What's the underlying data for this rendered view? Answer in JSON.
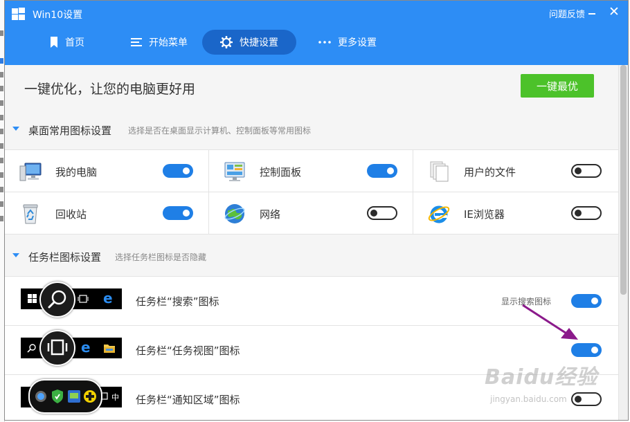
{
  "app": {
    "title": "Win10设置",
    "feedback": "问题反馈",
    "close_glyph": "✕"
  },
  "nav": {
    "tabs": [
      {
        "label": "首页",
        "icon": "bookmark-icon",
        "active": false
      },
      {
        "label": "开始菜单",
        "icon": "menu-icon",
        "active": false
      },
      {
        "label": "快捷设置",
        "icon": "gear-icon",
        "active": true
      },
      {
        "label": "更多设置",
        "icon": "more-icon",
        "active": false
      }
    ]
  },
  "optimize": {
    "text": "一键优化，让您的电脑更好用",
    "button": "一键最优"
  },
  "desktop_section": {
    "title": "桌面常用图标设置",
    "desc": "选择是否在桌面显示计算机、控制面板等常用图标",
    "items": [
      {
        "label": "我的电脑",
        "icon": "computer-icon",
        "on": true
      },
      {
        "label": "控制面板",
        "icon": "control-panel-icon",
        "on": true
      },
      {
        "label": "用户的文件",
        "icon": "documents-icon",
        "on": false
      },
      {
        "label": "回收站",
        "icon": "recycle-bin-icon",
        "on": true
      },
      {
        "label": "网络",
        "icon": "network-globe-icon",
        "on": false
      },
      {
        "label": "IE浏览器",
        "icon": "ie-browser-icon",
        "on": false
      }
    ]
  },
  "taskbar_section": {
    "title": "任务栏图标设置",
    "desc": "选择任务栏图标是否隐藏",
    "items": [
      {
        "label": "任务栏“搜索”图标",
        "hint": "显示搜索图标",
        "on": true
      },
      {
        "label": "任务栏“任务视图”图标",
        "on": true
      },
      {
        "label": "任务栏“通知区域”图标",
        "on": false,
        "ime": "中"
      }
    ]
  },
  "watermark": {
    "main": "Baidu经验",
    "sub": "jingyan.baidu.com"
  },
  "colors": {
    "header": "#2d8df5",
    "active_tab": "#1a66c9",
    "toggle_on": "#1f7fe6",
    "optimize_button": "#4cc22a",
    "annotation_arrow": "#8b1a8b"
  }
}
